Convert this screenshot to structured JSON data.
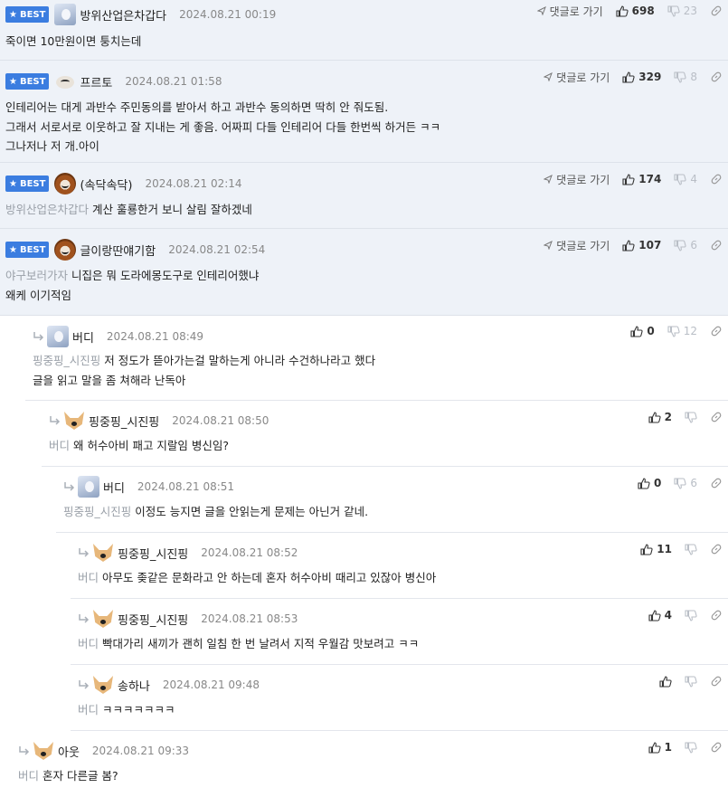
{
  "ui": {
    "best_label": "BEST",
    "goto_label": "댓글로 가기"
  },
  "comments": [
    {
      "nick": "방위산업은차갑다",
      "date": "2024.08.21 00:19",
      "up": "698",
      "down": "23",
      "mention": "",
      "body": "죽이면 10만원이면 퉁치는데"
    },
    {
      "nick": "프르토",
      "date": "2024.08.21 01:58",
      "up": "329",
      "down": "8",
      "mention": "",
      "body": "인테리어는 대게 과반수 주민동의를 받아서 하고 과반수 동의하면 딱히 안 줘도됨.\n그래서 서로서로 이웃하고 잘 지내는 게 좋음. 어짜피 다들 인테리어 다들 한번씩 하거든 ㅋㅋ\n그나저나 저 개.아이"
    },
    {
      "nick": "(속닥속닥)",
      "date": "2024.08.21 02:14",
      "up": "174",
      "down": "4",
      "mention": "방위산업은차갑다",
      "body": "계산 훌룡한거 보니 살림 잘하겠네"
    },
    {
      "nick": "글이랑딴얘기함",
      "date": "2024.08.21 02:54",
      "up": "107",
      "down": "6",
      "mention": "야구보러가자",
      "body": "니집은 뭐 도라에몽도구로 인테리어했냐\n왜케 이기적임"
    },
    {
      "nick": "버디",
      "date": "2024.08.21 08:49",
      "up": "0",
      "down": "12",
      "mention": "핑중핑_시진핑",
      "body": "저 정도가 뜯아가는걸 말하는게 아니라 수건하나라고 했다\n글을 읽고 말을 좀 쳐해라 난독아"
    },
    {
      "nick": "핑중핑_시진핑",
      "date": "2024.08.21 08:50",
      "up": "2",
      "down": "",
      "mention": "버디",
      "body": "왜 허수아비 패고 지랄임 병신임?"
    },
    {
      "nick": "버디",
      "date": "2024.08.21 08:51",
      "up": "0",
      "down": "6",
      "mention": "핑중핑_시진핑",
      "body": "이정도 능지면 글을 안읽는게 문제는 아닌거 같네."
    },
    {
      "nick": "핑중핑_시진핑",
      "date": "2024.08.21 08:52",
      "up": "11",
      "down": "",
      "mention": "버디",
      "body": "아무도 좆같은 문화라고 안 하는데 혼자 허수아비 때리고 있잖아 병신아"
    },
    {
      "nick": "핑중핑_시진핑",
      "date": "2024.08.21 08:53",
      "up": "4",
      "down": "",
      "mention": "버디",
      "body": "빡대가리 새끼가 괜히 일침 한 번 날려서 지적 우월감 맛보려고 ㅋㅋ"
    },
    {
      "nick": "송하나",
      "date": "2024.08.21 09:48",
      "up": "",
      "down": "",
      "mention": "버디",
      "body": "ㅋㅋㅋㅋㅋㅋㅋ"
    },
    {
      "nick": "아웃",
      "date": "2024.08.21 09:33",
      "up": "1",
      "down": "",
      "mention": "버디",
      "body": "혼자 다른글 봄?"
    }
  ]
}
